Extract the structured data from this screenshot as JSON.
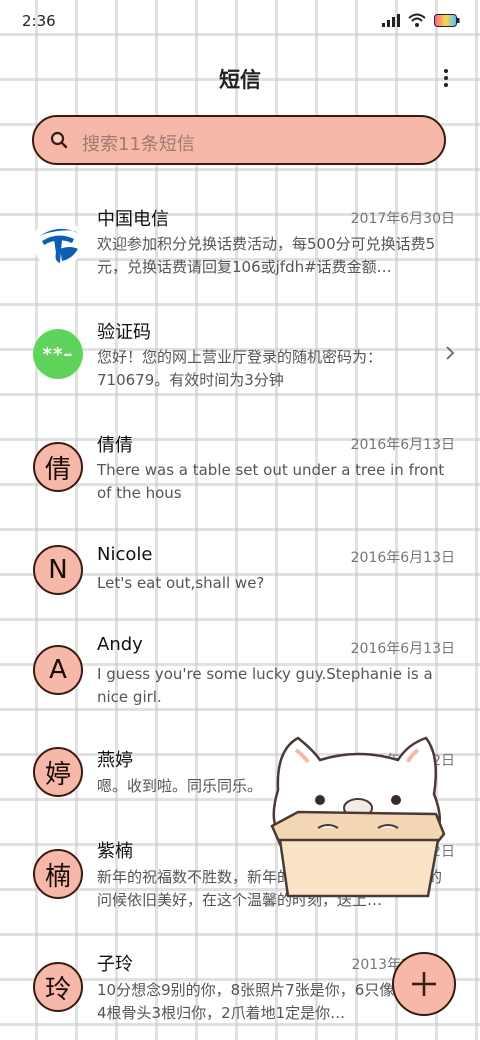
{
  "status": {
    "time": "2:36"
  },
  "header": {
    "title": "短信"
  },
  "search": {
    "placeholder": "搜索11条短信"
  },
  "conversations": [
    {
      "name": "中国电信",
      "date": "2017年6月30日",
      "preview": "欢迎参加积分兑换话费活动，每500分可兑换话费5元，兑换话费请回复106或jfdh#话费金额…",
      "avatar_type": "logo",
      "avatar_icon": "china-telecom-logo"
    },
    {
      "name": "验证码",
      "date": "",
      "preview": "您好！您的网上营业厅登录的随机密码为：710679。有效时间为3分钟",
      "avatar_type": "green",
      "avatar_text": "**–"
    },
    {
      "name": "倩倩",
      "date": "2016年6月13日",
      "preview": "There was a table set out under a tree in front of the hous",
      "avatar_text": "倩"
    },
    {
      "name": "Nicole",
      "date": "2016年6月13日",
      "preview": "Let's eat out,shall we?",
      "avatar_text": "N"
    },
    {
      "name": "Andy",
      "date": "2016年6月13日",
      "preview": "I guess you're some lucky guy.Stephanie is a nice girl.",
      "avatar_text": "A"
    },
    {
      "name": "燕婷",
      "date": "2013年2月22日",
      "preview": "嗯。收到啦。同乐同乐。",
      "avatar_text": "婷"
    },
    {
      "name": "紫楠",
      "date": "2013年2月22日",
      "preview": "新年的祝福数不胜数，新年的愿望好多好多，新年的问候依旧美好，在这个温馨的时刻，送上…",
      "avatar_text": "楠"
    },
    {
      "name": "子玲",
      "date": "2013年2",
      "preview": "10分想念9别的你，8张照片7张是你，6只像你，4根骨头3根归你，2爪着地1定是你…",
      "avatar_text": "玲"
    }
  ],
  "colors": {
    "accent": "#f6b8a8",
    "border": "#3a1a12",
    "verify_green": "#5fd45a",
    "telecom_blue": "#0a5fb4"
  }
}
